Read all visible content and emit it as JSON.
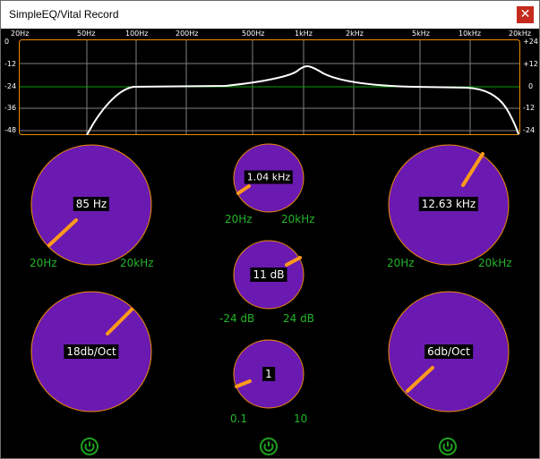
{
  "window": {
    "title": "SimpleEQ/Vital Record",
    "close_glyph": "✕"
  },
  "analyzer": {
    "freq_labels": [
      "20Hz",
      "50Hz",
      "100Hz",
      "200Hz",
      "500Hz",
      "1kHz",
      "2kHz",
      "5kHz",
      "10kHz",
      "20kHz"
    ],
    "db_labels_left": [
      "0",
      "-12",
      "-24",
      "-36",
      "-48"
    ],
    "db_labels_right": [
      "+24",
      "+12",
      "0",
      "-12",
      "-24"
    ],
    "curve_color": "#ffffff",
    "grid_color": "#808080",
    "zero_line_color": "#00a000",
    "border_color": "#f08c00"
  },
  "knobs": {
    "lowcut_freq": {
      "value": "85 Hz",
      "min": "20Hz",
      "max": "20kHz"
    },
    "peak_freq": {
      "value": "1.04 kHz",
      "min": "20Hz",
      "max": "20kHz"
    },
    "highcut_freq": {
      "value": "12.63 kHz",
      "min": "20Hz",
      "max": "20kHz"
    },
    "peak_gain": {
      "value": "11 dB",
      "min": "-24 dB",
      "max": "24 dB"
    },
    "peak_quality": {
      "value": "1",
      "min": "0.1",
      "max": "10"
    },
    "lowcut_slope": {
      "value": "18db/Oct"
    },
    "highcut_slope": {
      "value": "6db/Oct"
    }
  },
  "colors": {
    "knob_fill": "#6a1ab0",
    "knob_border": "#f08c00",
    "pointer": "#ff9a1a",
    "range_text": "#24b52a",
    "power_icon": "#1fa01f"
  }
}
